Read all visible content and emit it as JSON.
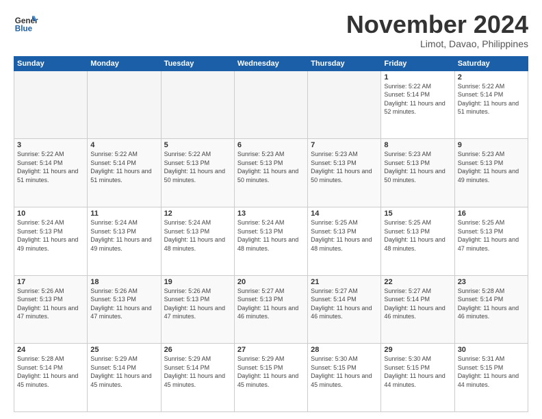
{
  "header": {
    "logo_line1": "General",
    "logo_line2": "Blue",
    "month": "November 2024",
    "location": "Limot, Davao, Philippines"
  },
  "days_of_week": [
    "Sunday",
    "Monday",
    "Tuesday",
    "Wednesday",
    "Thursday",
    "Friday",
    "Saturday"
  ],
  "weeks": [
    [
      {
        "day": "",
        "empty": true
      },
      {
        "day": "",
        "empty": true
      },
      {
        "day": "",
        "empty": true
      },
      {
        "day": "",
        "empty": true
      },
      {
        "day": "",
        "empty": true
      },
      {
        "day": "1",
        "sunrise": "Sunrise: 5:22 AM",
        "sunset": "Sunset: 5:14 PM",
        "daylight": "Daylight: 11 hours and 52 minutes."
      },
      {
        "day": "2",
        "sunrise": "Sunrise: 5:22 AM",
        "sunset": "Sunset: 5:14 PM",
        "daylight": "Daylight: 11 hours and 51 minutes."
      }
    ],
    [
      {
        "day": "3",
        "sunrise": "Sunrise: 5:22 AM",
        "sunset": "Sunset: 5:14 PM",
        "daylight": "Daylight: 11 hours and 51 minutes."
      },
      {
        "day": "4",
        "sunrise": "Sunrise: 5:22 AM",
        "sunset": "Sunset: 5:14 PM",
        "daylight": "Daylight: 11 hours and 51 minutes."
      },
      {
        "day": "5",
        "sunrise": "Sunrise: 5:22 AM",
        "sunset": "Sunset: 5:13 PM",
        "daylight": "Daylight: 11 hours and 50 minutes."
      },
      {
        "day": "6",
        "sunrise": "Sunrise: 5:23 AM",
        "sunset": "Sunset: 5:13 PM",
        "daylight": "Daylight: 11 hours and 50 minutes."
      },
      {
        "day": "7",
        "sunrise": "Sunrise: 5:23 AM",
        "sunset": "Sunset: 5:13 PM",
        "daylight": "Daylight: 11 hours and 50 minutes."
      },
      {
        "day": "8",
        "sunrise": "Sunrise: 5:23 AM",
        "sunset": "Sunset: 5:13 PM",
        "daylight": "Daylight: 11 hours and 50 minutes."
      },
      {
        "day": "9",
        "sunrise": "Sunrise: 5:23 AM",
        "sunset": "Sunset: 5:13 PM",
        "daylight": "Daylight: 11 hours and 49 minutes."
      }
    ],
    [
      {
        "day": "10",
        "sunrise": "Sunrise: 5:24 AM",
        "sunset": "Sunset: 5:13 PM",
        "daylight": "Daylight: 11 hours and 49 minutes."
      },
      {
        "day": "11",
        "sunrise": "Sunrise: 5:24 AM",
        "sunset": "Sunset: 5:13 PM",
        "daylight": "Daylight: 11 hours and 49 minutes."
      },
      {
        "day": "12",
        "sunrise": "Sunrise: 5:24 AM",
        "sunset": "Sunset: 5:13 PM",
        "daylight": "Daylight: 11 hours and 48 minutes."
      },
      {
        "day": "13",
        "sunrise": "Sunrise: 5:24 AM",
        "sunset": "Sunset: 5:13 PM",
        "daylight": "Daylight: 11 hours and 48 minutes."
      },
      {
        "day": "14",
        "sunrise": "Sunrise: 5:25 AM",
        "sunset": "Sunset: 5:13 PM",
        "daylight": "Daylight: 11 hours and 48 minutes."
      },
      {
        "day": "15",
        "sunrise": "Sunrise: 5:25 AM",
        "sunset": "Sunset: 5:13 PM",
        "daylight": "Daylight: 11 hours and 48 minutes."
      },
      {
        "day": "16",
        "sunrise": "Sunrise: 5:25 AM",
        "sunset": "Sunset: 5:13 PM",
        "daylight": "Daylight: 11 hours and 47 minutes."
      }
    ],
    [
      {
        "day": "17",
        "sunrise": "Sunrise: 5:26 AM",
        "sunset": "Sunset: 5:13 PM",
        "daylight": "Daylight: 11 hours and 47 minutes."
      },
      {
        "day": "18",
        "sunrise": "Sunrise: 5:26 AM",
        "sunset": "Sunset: 5:13 PM",
        "daylight": "Daylight: 11 hours and 47 minutes."
      },
      {
        "day": "19",
        "sunrise": "Sunrise: 5:26 AM",
        "sunset": "Sunset: 5:13 PM",
        "daylight": "Daylight: 11 hours and 47 minutes."
      },
      {
        "day": "20",
        "sunrise": "Sunrise: 5:27 AM",
        "sunset": "Sunset: 5:13 PM",
        "daylight": "Daylight: 11 hours and 46 minutes."
      },
      {
        "day": "21",
        "sunrise": "Sunrise: 5:27 AM",
        "sunset": "Sunset: 5:14 PM",
        "daylight": "Daylight: 11 hours and 46 minutes."
      },
      {
        "day": "22",
        "sunrise": "Sunrise: 5:27 AM",
        "sunset": "Sunset: 5:14 PM",
        "daylight": "Daylight: 11 hours and 46 minutes."
      },
      {
        "day": "23",
        "sunrise": "Sunrise: 5:28 AM",
        "sunset": "Sunset: 5:14 PM",
        "daylight": "Daylight: 11 hours and 46 minutes."
      }
    ],
    [
      {
        "day": "24",
        "sunrise": "Sunrise: 5:28 AM",
        "sunset": "Sunset: 5:14 PM",
        "daylight": "Daylight: 11 hours and 45 minutes."
      },
      {
        "day": "25",
        "sunrise": "Sunrise: 5:29 AM",
        "sunset": "Sunset: 5:14 PM",
        "daylight": "Daylight: 11 hours and 45 minutes."
      },
      {
        "day": "26",
        "sunrise": "Sunrise: 5:29 AM",
        "sunset": "Sunset: 5:14 PM",
        "daylight": "Daylight: 11 hours and 45 minutes."
      },
      {
        "day": "27",
        "sunrise": "Sunrise: 5:29 AM",
        "sunset": "Sunset: 5:15 PM",
        "daylight": "Daylight: 11 hours and 45 minutes."
      },
      {
        "day": "28",
        "sunrise": "Sunrise: 5:30 AM",
        "sunset": "Sunset: 5:15 PM",
        "daylight": "Daylight: 11 hours and 45 minutes."
      },
      {
        "day": "29",
        "sunrise": "Sunrise: 5:30 AM",
        "sunset": "Sunset: 5:15 PM",
        "daylight": "Daylight: 11 hours and 44 minutes."
      },
      {
        "day": "30",
        "sunrise": "Sunrise: 5:31 AM",
        "sunset": "Sunset: 5:15 PM",
        "daylight": "Daylight: 11 hours and 44 minutes."
      }
    ]
  ]
}
